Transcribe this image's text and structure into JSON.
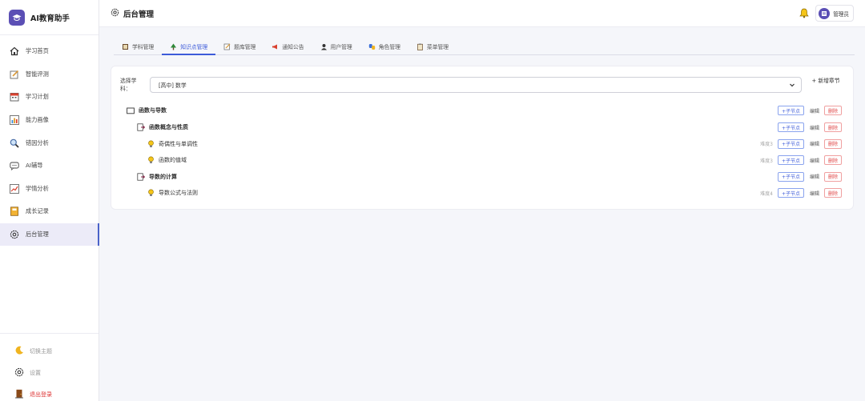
{
  "brand": {
    "title": "AI教育助手"
  },
  "sidebar": {
    "items": [
      {
        "label": "学习首页",
        "icon": "home-icon"
      },
      {
        "label": "智能评测",
        "icon": "edit-note-icon"
      },
      {
        "label": "学习计划",
        "icon": "calendar-icon"
      },
      {
        "label": "能力画像",
        "icon": "bar-chart-icon"
      },
      {
        "label": "错因分析",
        "icon": "magnifier-icon"
      },
      {
        "label": "AI辅导",
        "icon": "chat-bubble-icon"
      },
      {
        "label": "学情分析",
        "icon": "trend-chart-icon"
      },
      {
        "label": "成长记录",
        "icon": "notebook-icon"
      },
      {
        "label": "后台管理",
        "icon": "gear-icon"
      }
    ],
    "active_index": 8,
    "bottom": {
      "theme_label": "切换主题",
      "settings_label": "设置",
      "logout_label": "退出登录"
    }
  },
  "header": {
    "title": "后台管理",
    "user_label": "管理员"
  },
  "tabs": [
    {
      "label": "学科管理",
      "icon": "book-icon"
    },
    {
      "label": "知识点管理",
      "icon": "tree-icon"
    },
    {
      "label": "题库管理",
      "icon": "memo-icon"
    },
    {
      "label": "通知公告",
      "icon": "megaphone-icon"
    },
    {
      "label": "用户管理",
      "icon": "user-icon"
    },
    {
      "label": "角色管理",
      "icon": "masks-icon"
    },
    {
      "label": "菜单管理",
      "icon": "clipboard-icon"
    }
  ],
  "active_tab": 1,
  "knowledge": {
    "select_label": "选择学科：",
    "selected_subject": "[高中] 数学",
    "new_chapter_label": "+ 新增章节",
    "nodes": [
      {
        "label": "函数与导数",
        "level": 0,
        "difficulty": ""
      },
      {
        "label": "函数概念与性质",
        "level": 1,
        "difficulty": ""
      },
      {
        "label": "奇偶性与单调性",
        "level": 2,
        "difficulty": "难度3"
      },
      {
        "label": "函数的值域",
        "level": 2,
        "difficulty": "难度3"
      },
      {
        "label": "导数的计算",
        "level": 1,
        "difficulty": ""
      },
      {
        "label": "导数公式与法则",
        "level": 2,
        "difficulty": "难度4"
      }
    ],
    "add_child_label": "+子节点",
    "edit_label": "编辑",
    "delete_label": "删除"
  },
  "colors": {
    "accent": "#3d5bd9",
    "brand": "#5b4fb5",
    "danger": "#e04848",
    "active_bg": "#ecebf8"
  }
}
